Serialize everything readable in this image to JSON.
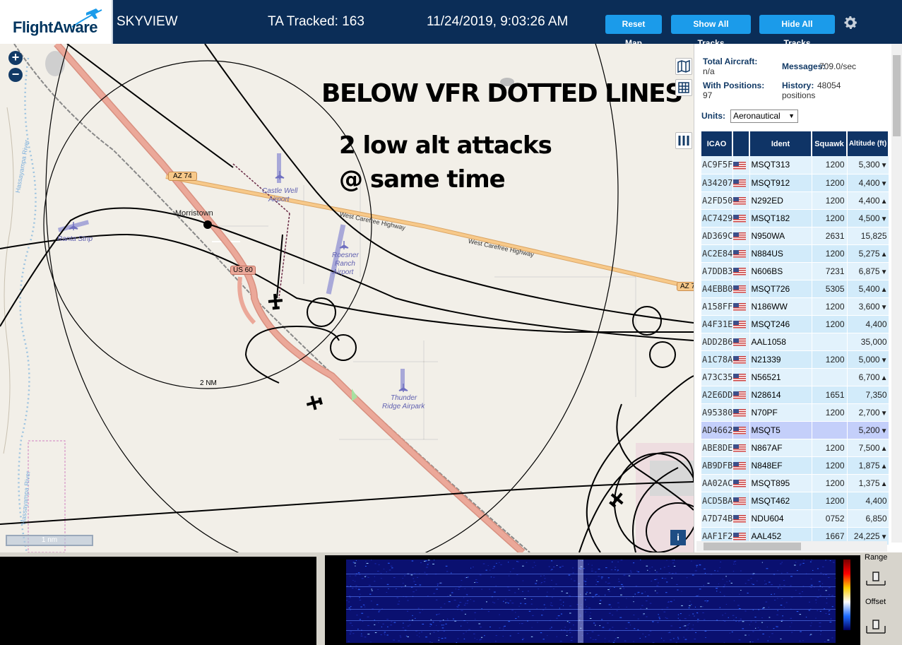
{
  "header": {
    "logo": "FlightAware",
    "app_name": "SKYVIEW",
    "tracked": "TA Tracked: 163",
    "datetime": "11/24/2019, 9:03:26 AM",
    "btn_reset": "Reset Map",
    "btn_show": "Show All Tracks",
    "btn_hide": "Hide All Tracks"
  },
  "map": {
    "annotation_title": "BELOW VFR DOTTED LINES",
    "annotation_line1": "2 low alt attacks",
    "annotation_line2": "@ same time",
    "labels": {
      "az74_left": "AZ 74",
      "az74_right": "AZ 7",
      "morristown": "Morristown",
      "castle_well": "Castle Well",
      "castle_well_2": "Airport",
      "ranta": "Ranta Strip",
      "roesner_1": "Roesner",
      "roesner_2": "Ranch",
      "roesner_3": "Airport",
      "hwy_1": "West Carefree Highway",
      "hwy_2": "West Carefree Highway",
      "us60": "US 60",
      "thunder_1": "Thunder",
      "thunder_2": "Ridge Airpark",
      "range_ring": "2 NM",
      "river_1": "Hassayampa River",
      "river_2": "Hassayampa River",
      "scale": "1 nm",
      "info": "i"
    }
  },
  "panel": {
    "total_label": "Total Aircraft:",
    "total_value": "n/a",
    "positions_label": "With Positions:",
    "positions_value": "97",
    "messages_label": "Messages:",
    "messages_value": "709.0/sec",
    "history_label": "History:",
    "history_value": "48054",
    "history_value2": "positions",
    "units_label": "Units:",
    "units_value": "Aeronautical",
    "columns": [
      "ICAO",
      "",
      "Ident",
      "Squawk",
      "Altitude (ft)"
    ]
  },
  "aircraft": [
    {
      "icao": "AC9F5F",
      "ident": "MSQT313",
      "squawk": "1200",
      "alt": "5,300",
      "trend": "▼"
    },
    {
      "icao": "A34207",
      "ident": "MSQT912",
      "squawk": "1200",
      "alt": "4,400",
      "trend": "▼"
    },
    {
      "icao": "A2FD50",
      "ident": "N292ED",
      "squawk": "1200",
      "alt": "4,400",
      "trend": "▲"
    },
    {
      "icao": "AC7429",
      "ident": "MSQT182",
      "squawk": "1200",
      "alt": "4,500",
      "trend": "▼"
    },
    {
      "icao": "AD369C",
      "ident": "N950WA",
      "squawk": "2631",
      "alt": "15,825",
      "trend": ""
    },
    {
      "icao": "AC2E84",
      "ident": "N884US",
      "squawk": "1200",
      "alt": "5,275",
      "trend": "▲"
    },
    {
      "icao": "A7DDB3",
      "ident": "N606BS",
      "squawk": "7231",
      "alt": "6,875",
      "trend": "▼"
    },
    {
      "icao": "A4EBB0",
      "ident": "MSQT726",
      "squawk": "5305",
      "alt": "5,400",
      "trend": "▲"
    },
    {
      "icao": "A158FF",
      "ident": "N186WW",
      "squawk": "1200",
      "alt": "3,600",
      "trend": "▼"
    },
    {
      "icao": "A4F31E",
      "ident": "MSQT246",
      "squawk": "1200",
      "alt": "4,400",
      "trend": ""
    },
    {
      "icao": "ADD2B6",
      "ident": "AAL1058",
      "squawk": "",
      "alt": "35,000",
      "trend": ""
    },
    {
      "icao": "A1C78A",
      "ident": "N21339",
      "squawk": "1200",
      "alt": "5,000",
      "trend": "▼"
    },
    {
      "icao": "A73C35",
      "ident": "N56521",
      "squawk": "",
      "alt": "6,700",
      "trend": "▲"
    },
    {
      "icao": "A2E6DD",
      "ident": "N28614",
      "squawk": "1651",
      "alt": "7,350",
      "trend": ""
    },
    {
      "icao": "A95380",
      "ident": "N70PF",
      "squawk": "1200",
      "alt": "2,700",
      "trend": "▼"
    },
    {
      "icao": "AD4662",
      "ident": "MSQT5",
      "squawk": "",
      "alt": "5,200",
      "trend": "▼"
    },
    {
      "icao": "ABE8DE",
      "ident": "N867AF",
      "squawk": "1200",
      "alt": "7,500",
      "trend": "▲"
    },
    {
      "icao": "AB9DFB",
      "ident": "N848EF",
      "squawk": "1200",
      "alt": "1,875",
      "trend": "▲"
    },
    {
      "icao": "AA02AC",
      "ident": "MSQT895",
      "squawk": "1200",
      "alt": "1,375",
      "trend": "▲"
    },
    {
      "icao": "ACD5BA",
      "ident": "MSQT462",
      "squawk": "1200",
      "alt": "4,400",
      "trend": ""
    },
    {
      "icao": "A7D74B",
      "ident": "NDU604",
      "squawk": "0752",
      "alt": "6,850",
      "trend": ""
    },
    {
      "icao": "AAF1F2",
      "ident": "AAL452",
      "squawk": "1667",
      "alt": "24,225",
      "trend": "▼"
    }
  ],
  "bottom": {
    "range_label": "Range",
    "offset_label": "Offset"
  },
  "colors": {
    "header_bg": "#0b2d57",
    "button_bg": "#1b9bea",
    "road_major": "#e8a08a",
    "road_highway": "#f7c98a"
  }
}
